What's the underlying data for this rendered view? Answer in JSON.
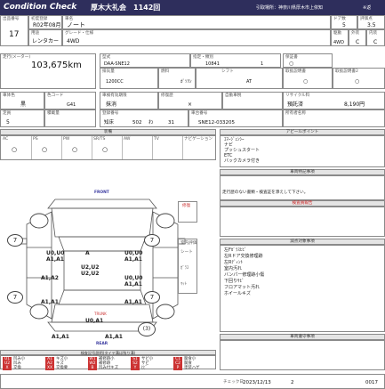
{
  "header": {
    "brand": "Condition Check",
    "venue": "厚木大礼会",
    "lot_no": "1142回",
    "location": "引取場所：神奈川県厚木市上依知",
    "stamp": "※返"
  },
  "vehicle": {
    "lot_label": "出品番号",
    "lot_value": "17",
    "first_reg_label": "初度登録",
    "first_reg_value": "R02年08月",
    "model_name_label": "車名",
    "model_name_value": "ノート",
    "grade_label": "グレード・仕様",
    "grade_value": "4WD",
    "use_label": "用途",
    "use_value": "レンタカー",
    "doors_label": "ドア数",
    "doors_value": "5",
    "score_label": "評価点",
    "score_value": "3.5",
    "drive_label": "駆動",
    "drive_value": "4WD",
    "ext_label": "外装",
    "ext_value": "C",
    "int_label": "内装",
    "int_value": "C",
    "mileage_label": "走行(メーター)",
    "mileage_value": "103,675km",
    "model_code_label": "型式",
    "model_code_value": "DAA-SNE12",
    "reg_no_label": "指定・類別",
    "reg_no_value": "10841",
    "reg_no2_value": "1",
    "capacity_label": "排気量",
    "capacity_value": "1200CC",
    "fuel_label": "燃料",
    "fuel_value": "ｶﾞｿﾘﾝ",
    "mission_label": "シフト",
    "mission_value": "AT",
    "inspection_label": "保証書",
    "inspection_value": "○",
    "manual_label": "取扱説明書",
    "manual_value": "○",
    "recycle_label": "取扱説明書2",
    "recycle_value": "○",
    "color_label": "車体色",
    "color_value": "黒",
    "color_code_label": "色コード",
    "color_code_value": "G41",
    "shaken_label": "車検有効期限",
    "shaken_value": "抹消",
    "repair_label": "修復歴",
    "repair_value": "×",
    "tax_label": "自動車税",
    "tax_value": "",
    "recycle_fee_label": "リサイクル料",
    "recycle_fee_value": "預託済",
    "recycle_fee_amount": "8,190円",
    "seats_label": "定員",
    "seats_value": "5",
    "weight_label": "積載量",
    "weight_value": "",
    "plate_label": "登録番号",
    "plate_region": "知床",
    "plate_class": "502",
    "plate_kana": "わ",
    "plate_num": "31",
    "chassis_label": "車台番号",
    "chassis_value": "SNE12-033205",
    "owner_label": "所有者名称",
    "owner_value": ""
  },
  "equipment": {
    "title": "装備",
    "headers": [
      "AC",
      "PS",
      "PW",
      "SR/TS",
      "AW",
      "TV",
      "ナビゲーション"
    ],
    "values": [
      "○",
      "○",
      "○",
      "○",
      "",
      "",
      ""
    ]
  },
  "appeal": {
    "title": "アピールポイント",
    "lines": [
      "ｴﾏｰｼﾞｪﾝｼｰ",
      "ナビ",
      "プッシュスタート",
      "ETC",
      "バックカメラ付き"
    ]
  },
  "special_notes": {
    "title": "車両特記事項",
    "text": "走行歴のない書類・検査証を添えして下さい。"
  },
  "inspector_notes": {
    "title": "検査員報告",
    "text": ""
  },
  "repair_notes": {
    "title": "減点対象事項",
    "lines": [
      "左Fｶﾞﾗｽﾋﾋﾞ",
      "左Rドア交換修理跡",
      "左Rﾃﾞｨﾝﾄ",
      "室内汚れ",
      "バンパー修理跡小傷",
      "下回りｻﾋﾞ",
      "フロアマット汚れ",
      "ホイールキズ"
    ]
  },
  "buyer_notes": {
    "title": "車両遵守事項",
    "text": ""
  },
  "diagram": {
    "front_label": "FRONT",
    "rear_label": "REAR",
    "trunk_label": "TRUNK",
    "interior_title": "室内",
    "interior_items": [
      "シート",
      "ｶﾞﾗｽ",
      "ﾏｯﾄ"
    ],
    "section_labels": [
      "修復",
      "室内評価"
    ],
    "damage": {
      "hood": "U0,U0",
      "hood2": "A1,A1",
      "roof": "A",
      "roof_center": "U2,U2",
      "roof_center2": "U2,U2",
      "left_front": "U0,U0",
      "left_front2": "A1,A1",
      "left_mid": "A1,A2",
      "right_front": "U0,U0",
      "right_front2": "A1,A1",
      "left_rear": "A1,A1",
      "right_rear": "A1,A1",
      "rear_bumper": "U0,A1",
      "rear_corner_l": "A1,A1",
      "rear_corner_r": "A1,A1"
    },
    "tires": [
      "7",
      "7",
      "7",
      "7"
    ],
    "spare_label": "(3)"
  },
  "legend": {
    "title": "検査記号説明(タイヤ溝は残り溝)",
    "items": [
      {
        "code": "U1",
        "text": "凹み小",
        "color": "#c33"
      },
      {
        "code": "A1",
        "text": "キズ小",
        "color": "#c33"
      },
      {
        "code": "W1",
        "text": "補修跡小",
        "color": "#c33"
      },
      {
        "code": "S1",
        "text": "サビ小",
        "color": "#c33"
      },
      {
        "code": "C1",
        "text": "腐食小",
        "color": "#c33"
      },
      {
        "code": "U2",
        "text": "凹み",
        "color": "#c33"
      },
      {
        "code": "A2",
        "text": "キズ",
        "color": "#c33"
      },
      {
        "code": "W2",
        "text": "補修跡",
        "color": "#c33"
      },
      {
        "code": "S2",
        "text": "サビ",
        "color": "#c33"
      },
      {
        "code": "C2",
        "text": "腐食",
        "color": "#c33"
      },
      {
        "code": "X",
        "text": "交換",
        "color": "#c33"
      },
      {
        "code": "XX",
        "text": "交換要",
        "color": "#c33"
      },
      {
        "code": "B",
        "text": "凹み付キズ",
        "color": "#c33"
      },
      {
        "code": "Y",
        "text": "ﾋﾋﾞ",
        "color": "#c33"
      },
      {
        "code": "P",
        "text": "塗装ハゲ",
        "color": "#c33"
      }
    ]
  },
  "footer": {
    "date_label": "チェック日",
    "date_value": "2023/12/13",
    "checker": "2",
    "sheet_no": "0017"
  }
}
